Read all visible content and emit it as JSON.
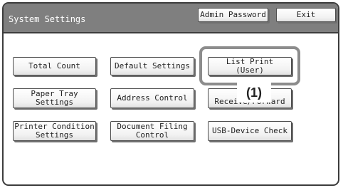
{
  "window": {
    "title": "System Settings"
  },
  "header": {
    "admin_password_label": "Admin Password",
    "exit_label": "Exit"
  },
  "menu": {
    "buttons": [
      "Total Count",
      "Default Settings",
      "List Print\n(User)",
      "Paper Tray\nSettings",
      "Address Control",
      "Receive/Forward",
      "Printer Condition\nSettings",
      "Document Filing\nControl",
      "USB-Device Check"
    ]
  },
  "callout": {
    "label": "(1)"
  },
  "colors": {
    "titlebar": "#7f7f7f",
    "frame": "#3c3c3c",
    "callout_ring": "#8c8c8c"
  }
}
